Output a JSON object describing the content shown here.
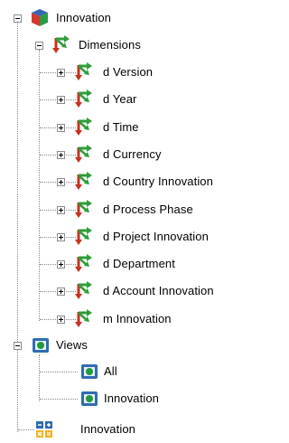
{
  "tree": {
    "root": {
      "label": "Innovation",
      "icon": "cube-icon",
      "expanded": true
    },
    "dimensions": {
      "label": "Dimensions",
      "icon": "dimension-icon",
      "expanded": true,
      "items": [
        {
          "label": "d Version"
        },
        {
          "label": "d Year"
        },
        {
          "label": "d Time"
        },
        {
          "label": "d Currency"
        },
        {
          "label": "d Country Innovation"
        },
        {
          "label": "d Process Phase"
        },
        {
          "label": "d Project Innovation"
        },
        {
          "label": "d Department"
        },
        {
          "label": "d Account Innovation"
        },
        {
          "label": "m Innovation"
        }
      ]
    },
    "views": {
      "label": "Views",
      "icon": "views-icon",
      "expanded": true,
      "items": [
        {
          "label": "All",
          "icon": "view-icon"
        },
        {
          "label": "Innovation",
          "icon": "view-icon"
        }
      ]
    },
    "calc": {
      "label": "Innovation",
      "icon": "calculator-icon"
    }
  },
  "colors": {
    "dimension_green": "#2e9e3a",
    "dimension_red": "#c8321e",
    "view_blue": "#2f6cb3",
    "view_green": "#1f9b3a",
    "cube_red": "#d23b2a",
    "cube_green": "#2f9a45",
    "cube_blue": "#3566b8"
  }
}
